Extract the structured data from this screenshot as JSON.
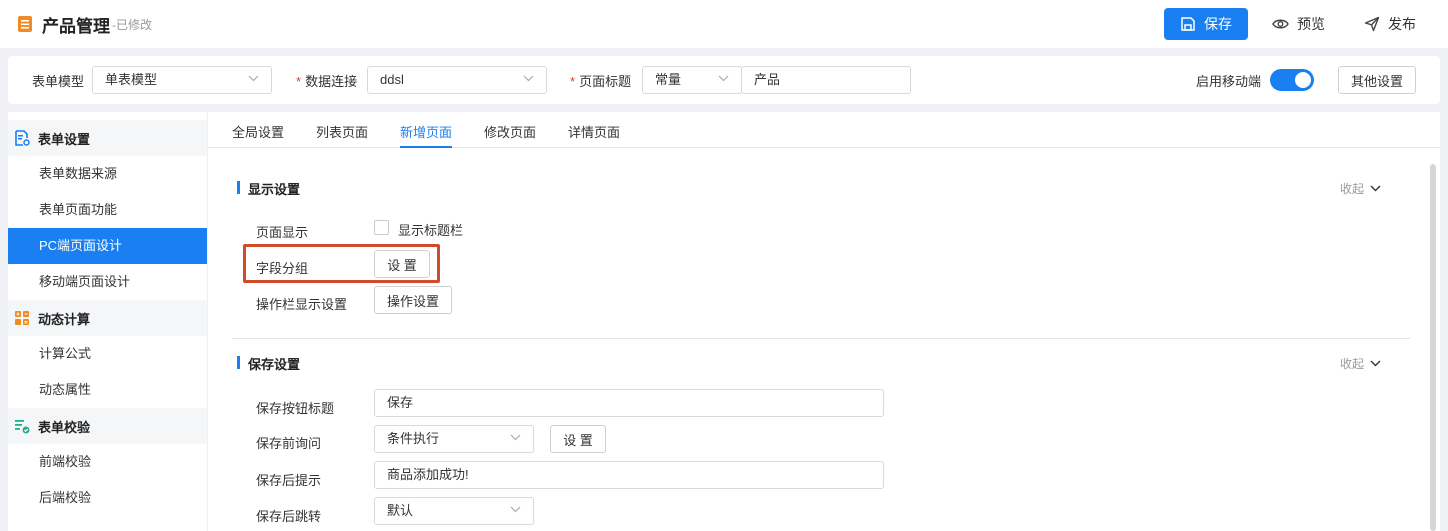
{
  "header": {
    "title": "产品管理",
    "status": "-已修改",
    "save_label": "保存",
    "preview_label": "预览",
    "publish_label": "发布"
  },
  "config": {
    "form_model_label": "表单模型",
    "form_model_value": "单表模型",
    "data_conn_label": "数据连接",
    "data_conn_value": "ddsl",
    "page_title_label": "页面标题",
    "page_title_type": "常量",
    "page_title_value": "产品",
    "mobile_label": "启用移动端",
    "mobile_enabled": true,
    "other_settings_label": "其他设置"
  },
  "sidebar": {
    "groups": [
      {
        "label": "表单设置",
        "icon": "form-settings-icon",
        "items": [
          "表单数据来源",
          "表单页面功能",
          "PC端页面设计",
          "移动端页面设计"
        ]
      },
      {
        "label": "动态计算",
        "icon": "calculator-icon",
        "items": [
          "计算公式",
          "动态属性"
        ]
      },
      {
        "label": "表单校验",
        "icon": "validation-icon",
        "items": [
          "前端校验",
          "后端校验"
        ]
      }
    ],
    "active_item": "PC端页面设计"
  },
  "tabs": [
    "全局设置",
    "列表页面",
    "新增页面",
    "修改页面",
    "详情页面"
  ],
  "active_tab": "新增页面",
  "display_section": {
    "title": "显示设置",
    "collapse_label": "收起",
    "page_display_label": "页面显示",
    "show_titlebar_label": "显示标题栏",
    "field_group_label": "字段分组",
    "field_group_button": "设 置",
    "action_bar_label": "操作栏显示设置",
    "action_bar_button": "操作设置"
  },
  "save_section": {
    "title": "保存设置",
    "collapse_label": "收起",
    "save_button_title_label": "保存按钮标题",
    "save_button_title_value": "保存",
    "pre_save_label": "保存前询问",
    "pre_save_value": "条件执行",
    "pre_save_button": "设 置",
    "post_save_tip_label": "保存后提示",
    "post_save_tip_value": "商品添加成功!",
    "post_save_jump_label": "保存后跳转",
    "post_save_jump_value": "默认"
  },
  "colors": {
    "accent": "#1a7ff0",
    "highlight": "#d04a2b"
  }
}
